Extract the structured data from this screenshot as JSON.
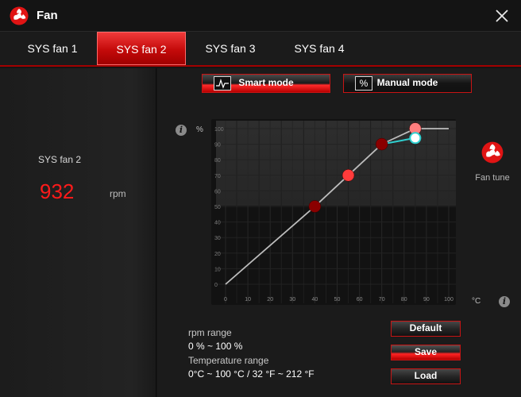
{
  "app": {
    "title": "Fan",
    "logo_icon": "msi-dragon-fan-icon",
    "accent": "#e60f0f"
  },
  "tabs": [
    {
      "label": "SYS fan 1",
      "active": false
    },
    {
      "label": "SYS fan 2",
      "active": true
    },
    {
      "label": "SYS fan 3",
      "active": false
    },
    {
      "label": "SYS fan 4",
      "active": false
    }
  ],
  "status": {
    "fan_name": "SYS fan 2",
    "rpm": "932",
    "rpm_unit": "rpm"
  },
  "modes": {
    "smart_label": "Smart mode",
    "manual_label": "Manual mode",
    "manual_icon_text": "%",
    "active": "smart"
  },
  "fan_tune": {
    "label": "Fan tune"
  },
  "ranges": {
    "rpm_label": "rpm range",
    "rpm_value": "0 % ~ 100 %",
    "temp_label": "Temperature range",
    "temp_value": "0°C ~ 100 °C / 32 °F ~ 212 °F"
  },
  "actions": {
    "default_label": "Default",
    "save_label": "Save",
    "load_label": "Load"
  },
  "chart_data": {
    "type": "line",
    "title": "",
    "ylabel": "%",
    "xlabel": "°C",
    "xlim": [
      0,
      100
    ],
    "ylim": [
      0,
      100
    ],
    "x_ticks": [
      0,
      10,
      20,
      30,
      40,
      50,
      60,
      70,
      80,
      90,
      100
    ],
    "y_ticks": [
      0,
      10,
      20,
      30,
      40,
      50,
      60,
      70,
      80,
      90,
      100
    ],
    "grid": true,
    "series": [
      {
        "points": [
          [
            0,
            0
          ],
          [
            40,
            50
          ],
          [
            55,
            70
          ],
          [
            70,
            90
          ],
          [
            85,
            100
          ],
          [
            100,
            100
          ]
        ],
        "color": "#bdbdbd",
        "role": "curve"
      },
      {
        "points": [
          [
            70,
            90
          ],
          [
            85,
            94
          ]
        ],
        "color": "#2fd0d0",
        "role": "current"
      }
    ],
    "control_points": [
      {
        "x": 40,
        "y": 50,
        "color": "#8a0000"
      },
      {
        "x": 55,
        "y": 70,
        "color": "#ff3b3b"
      },
      {
        "x": 70,
        "y": 90,
        "color": "#8a0000"
      },
      {
        "x": 85,
        "y": 100,
        "color": "#ff7f7f"
      }
    ],
    "current_point": {
      "x": 85,
      "y": 94,
      "color": "#2fd0d0"
    }
  }
}
